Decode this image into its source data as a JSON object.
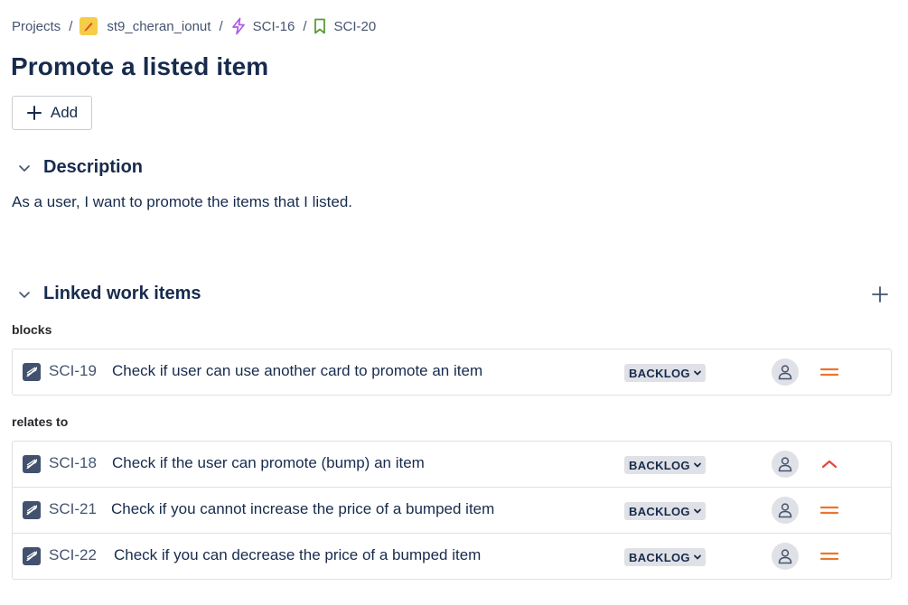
{
  "breadcrumb": {
    "projects": "Projects",
    "project": "st9_cheran_ionut",
    "epic": "SCI-16",
    "story": "SCI-20",
    "separator": "/"
  },
  "title": "Promote a listed item",
  "add_button": {
    "label": "Add"
  },
  "description": {
    "heading": "Description",
    "text": "As a user, I want to promote the items that I listed."
  },
  "linked": {
    "heading": "Linked work items",
    "groups": [
      {
        "label": "blocks",
        "items": [
          {
            "key": "SCI-19",
            "summary": "Check if user can use another card to promote an item",
            "status": "BACKLOG",
            "priority": "medium"
          }
        ]
      },
      {
        "label": "relates to",
        "items": [
          {
            "key": "SCI-18",
            "summary": "Check if the user can promote (bump) an item",
            "status": "BACKLOG",
            "priority": "high"
          },
          {
            "key": "SCI-21",
            "summary": "Check if you cannot increase the price of a bumped item",
            "status": "BACKLOG",
            "priority": "medium"
          },
          {
            "key": "SCI-22",
            "summary": "Check if you can decrease the price of a bumped item",
            "status": "BACKLOG",
            "priority": "medium"
          }
        ]
      }
    ]
  },
  "colors": {
    "project_icon": "#f5cd47",
    "epic_icon": "#b159e8",
    "story_icon": "#5b9a3c",
    "priority_medium": "#e8772e",
    "priority_high": "#e2483d"
  }
}
